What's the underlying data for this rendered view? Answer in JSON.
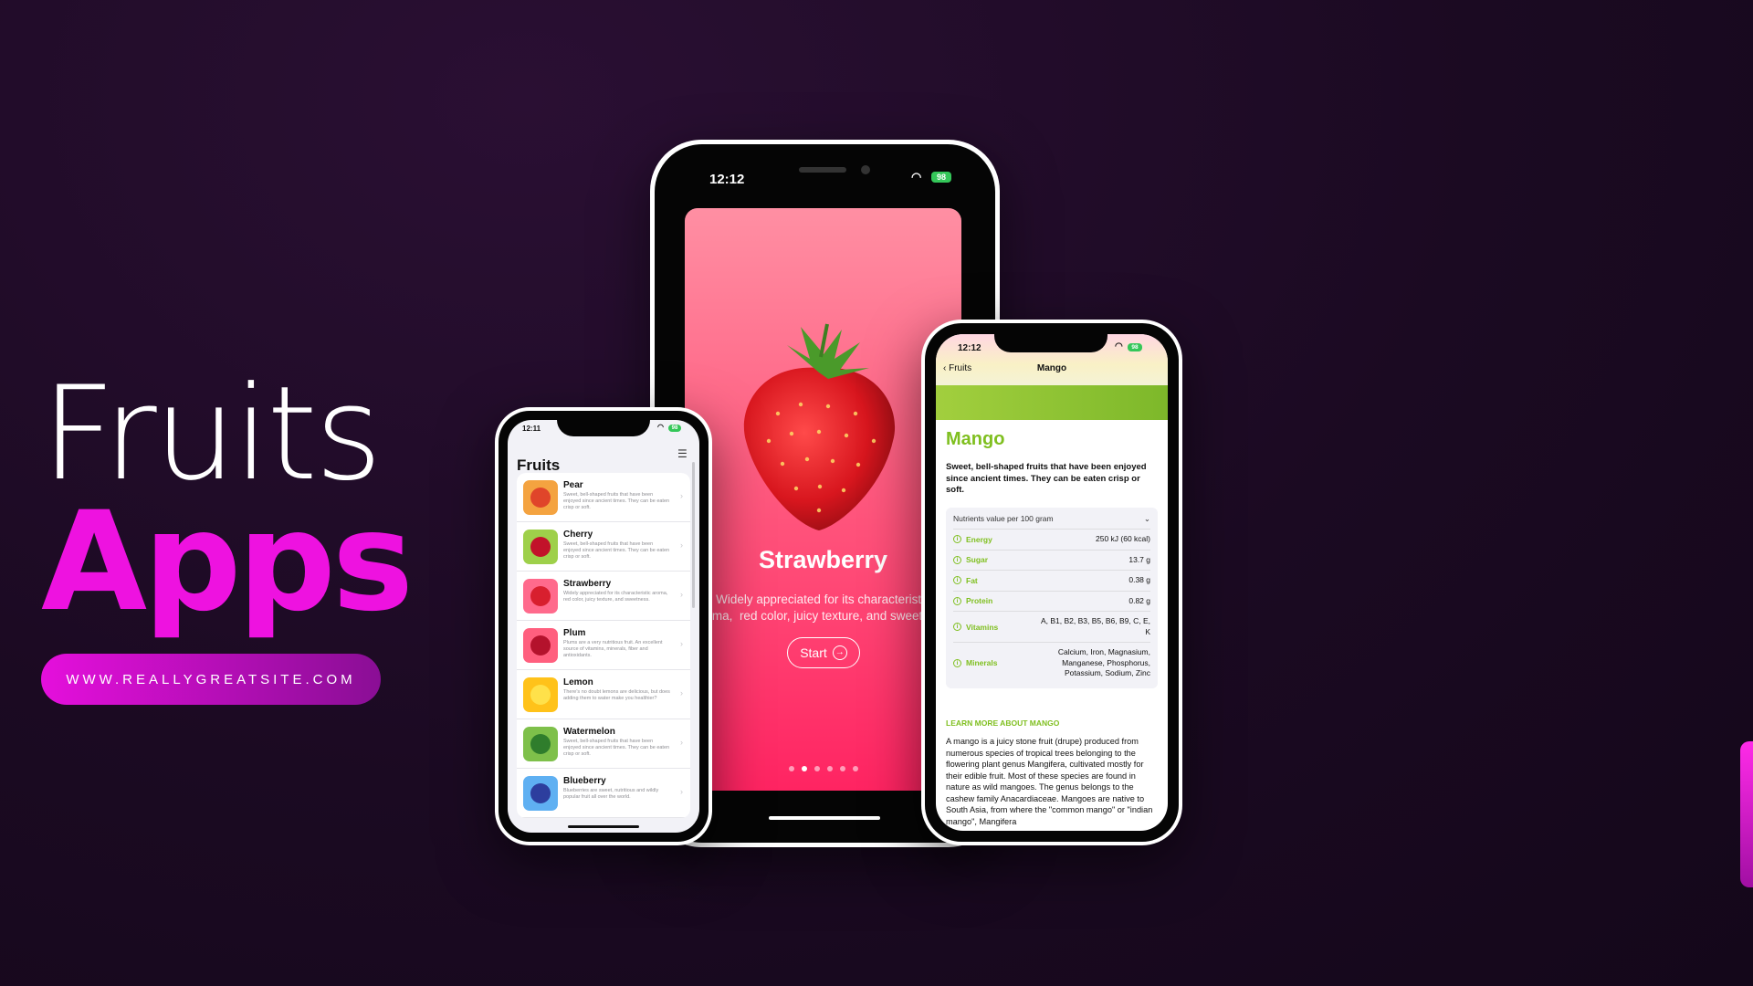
{
  "hero": {
    "title_line1": "Fruits",
    "title_line2": "Apps",
    "url": "WWW.REALLYGREATSITE.COM"
  },
  "colors": {
    "accent": "#ee12e0",
    "strawberry": "#ff4d78",
    "mango_green": "#7fbf1f"
  },
  "center_phone": {
    "time": "12:12",
    "battery": "98",
    "fruit_name": "Strawberry",
    "description": "Widely appreciated for its characteristic\naroma,  red color, juicy texture, and sweetness.",
    "start_label": "Start",
    "page_count": 6,
    "active_page": 1
  },
  "left_phone": {
    "time": "12:11",
    "battery": "98",
    "title": "Fruits",
    "items": [
      {
        "name": "Pear",
        "desc": "Sweet, bell-shaped fruits that have been enjoyed since ancient times. They can be eaten crisp or soft.",
        "bg": "#f4a340",
        "fruit": "#e0452a"
      },
      {
        "name": "Cherry",
        "desc": "Sweet, bell-shaped fruits that have been enjoyed since ancient times. They can be eaten crisp or soft.",
        "bg": "#9ed04a",
        "fruit": "#c2122a"
      },
      {
        "name": "Strawberry",
        "desc": "Widely appreciated for its characteristic aroma, red color, juicy texture, and sweetness.",
        "bg": "#ff6a8c",
        "fruit": "#d81f2e"
      },
      {
        "name": "Plum",
        "desc": "Plums are a very nutritious fruit. An excellent source of vitamins, minerals, fiber and antioxidants.",
        "bg": "#ff5f7e",
        "fruit": "#b4122c"
      },
      {
        "name": "Lemon",
        "desc": "There's no doubt lemons are delicious, but does adding them to water make you healthier?",
        "bg": "#ffc21a",
        "fruit": "#ffe14a"
      },
      {
        "name": "Watermelon",
        "desc": "Sweet, bell-shaped fruits that have been enjoyed since ancient times. They can be eaten crisp or soft.",
        "bg": "#7ec04a",
        "fruit": "#2f7d2c"
      },
      {
        "name": "Blueberry",
        "desc": "Blueberries are sweet, nutritious and wildly popular fruit all over the world.",
        "bg": "#5fb0f2",
        "fruit": "#2d3e9e"
      }
    ]
  },
  "right_phone": {
    "time": "12:12",
    "battery": "98",
    "back_label": "Fruits",
    "nav_title": "Mango",
    "name": "Mango",
    "lead": "Sweet, bell-shaped fruits that have been enjoyed since ancient times. They can be eaten crisp or soft.",
    "nutrients_header": "Nutrients value per 100 gram",
    "nutrients": [
      {
        "label": "Energy",
        "value": "250 kJ (60 kcal)"
      },
      {
        "label": "Sugar",
        "value": "13.7 g"
      },
      {
        "label": "Fat",
        "value": "0.38 g"
      },
      {
        "label": "Protein",
        "value": "0.82 g"
      },
      {
        "label": "Vitamins",
        "value": "A, B1, B2, B3, B5, B6, B9, C, E, K"
      },
      {
        "label": "Minerals",
        "value": "Calcium, Iron, Magnasium, Manganese, Phosphorus, Potassium, Sodium, Zinc"
      }
    ],
    "learn_more": "LEARN MORE ABOUT MANGO",
    "body": "A mango is a juicy stone fruit (drupe) produced from numerous species of tropical trees belonging to the flowering plant genus Mangifera, cultivated mostly for their edible fruit. Most of these species are found in nature as wild mangoes. The genus belongs to the cashew family Anacardiaceae. Mangoes are native to South Asia, from where the \"common mango\" or \"indian mango\", Mangifera"
  }
}
